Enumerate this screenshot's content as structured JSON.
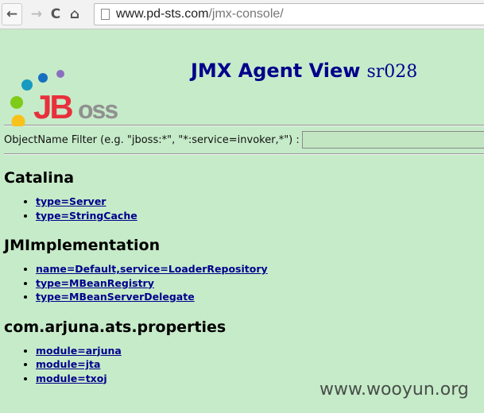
{
  "browser": {
    "url_host": "www.pd-sts.com",
    "url_path": "/jmx-console/",
    "back": "←",
    "forward": "→",
    "reload": "C",
    "home": "⌂"
  },
  "header": {
    "logo_text": "JBoss",
    "title": "JMX Agent View",
    "agent": "sr028"
  },
  "filter": {
    "label": "ObjectName Filter (e.g. \"jboss:*\", \"*:service=invoker,*\") :",
    "value": ""
  },
  "domains": [
    {
      "name": "Catalina",
      "items": [
        "type=Server",
        "type=StringCache"
      ]
    },
    {
      "name": "JMImplementation",
      "items": [
        "name=Default,service=LoaderRepository",
        "type=MBeanRegistry",
        "type=MBeanServerDelegate"
      ]
    },
    {
      "name": "com.arjuna.ats.properties",
      "items": [
        "module=arjuna",
        "module=jta",
        "module=txoj"
      ]
    }
  ],
  "watermark": "www.wooyun.org"
}
